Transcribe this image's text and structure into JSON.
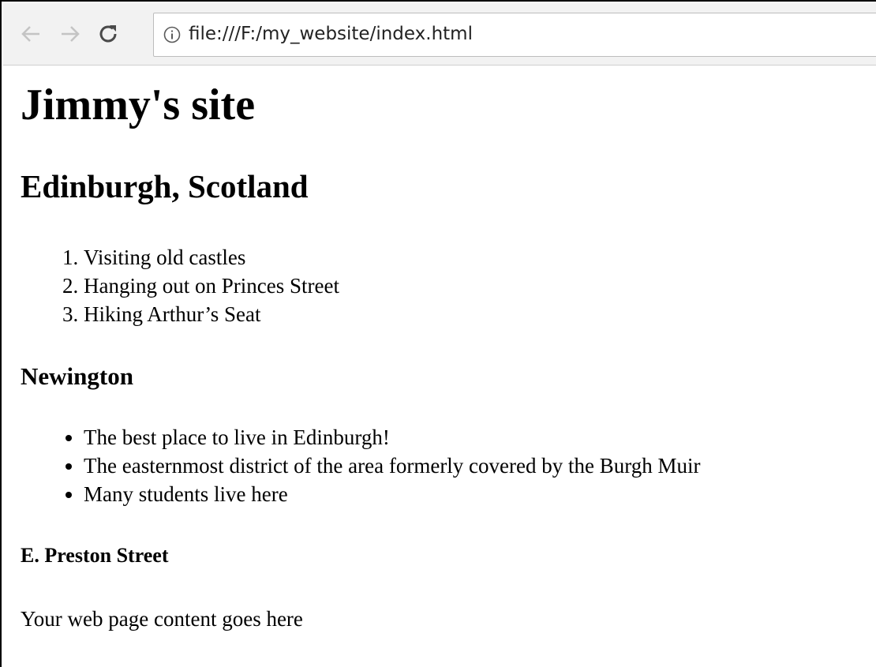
{
  "browser": {
    "url": "file:///F:/my_website/index.html",
    "icons": {
      "back": "back-arrow-icon",
      "forward": "forward-arrow-icon",
      "reload": "reload-icon",
      "info": "info-icon"
    }
  },
  "page": {
    "title": "Jimmy's site",
    "heading2": "Edinburgh, Scotland",
    "ordered_list": [
      "Visiting old castles",
      "Hanging out on Princes Street",
      "Hiking Arthur’s Seat"
    ],
    "heading3": "Newington",
    "bullet_list": [
      "The best place to live in Edinburgh!",
      "The easternmost district of the area formerly covered by the Burgh Muir",
      "Many students live here"
    ],
    "heading4": "E. Preston Street",
    "paragraph": "Your web page content goes here"
  }
}
